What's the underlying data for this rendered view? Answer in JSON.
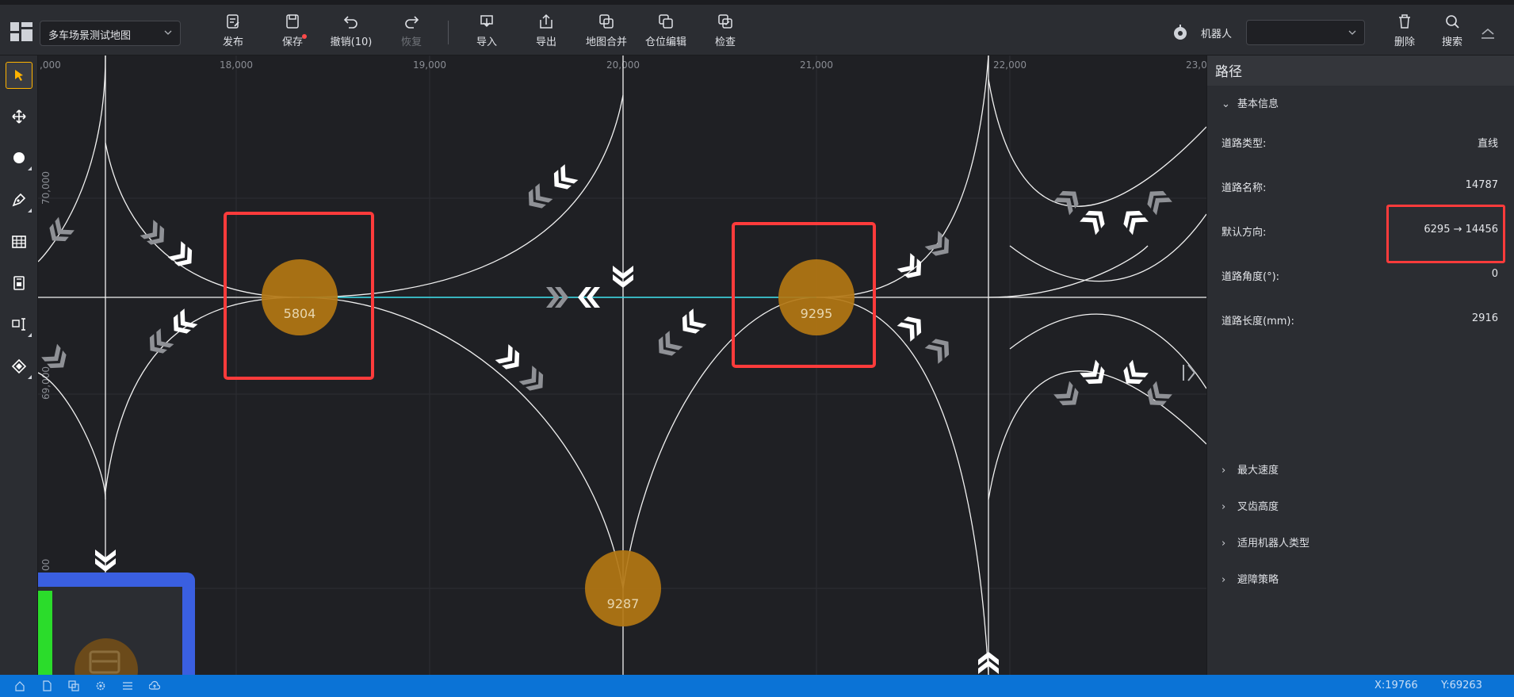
{
  "header": {
    "map_name": "多车场景测试地图",
    "tools": {
      "publish": "发布",
      "save": "保存",
      "undo": "撤销(10)",
      "redo": "恢复",
      "import": "导入",
      "export": "导出",
      "map_merge": "地图合并",
      "bin_edit": "仓位编辑",
      "check": "检查",
      "delete": "删除",
      "search": "搜索"
    },
    "robot_label": "机器人",
    "robot_value": ""
  },
  "canvas": {
    "ruler_x": [
      ",000",
      "18,000",
      "19,000",
      "20,000",
      "21,000",
      "22,000",
      "23,0"
    ],
    "ruler_y": [
      "70,000",
      "69,000",
      "00"
    ],
    "nodes": [
      {
        "id": "5804",
        "label": "5804"
      },
      {
        "id": "9295",
        "label": "9295"
      },
      {
        "id": "9287",
        "label": "9287"
      }
    ]
  },
  "panel": {
    "title": "路径",
    "basic_info": "基本信息",
    "props": [
      {
        "label": "道路类型:",
        "value": "直线"
      },
      {
        "label": "道路名称:",
        "value": "14787"
      },
      {
        "label": "默认方向:",
        "value": "6295 → 14456"
      },
      {
        "label": "道路角度(°):",
        "value": "0"
      },
      {
        "label": "道路长度(mm):",
        "value": "2916"
      }
    ],
    "sections": [
      {
        "label": "最大速度"
      },
      {
        "label": "叉齿高度"
      },
      {
        "label": "适用机器人类型"
      },
      {
        "label": "避障策略"
      }
    ]
  },
  "status": {
    "x": "X:19766",
    "y": "Y:69263"
  },
  "colors": {
    "accent": "#ffb300",
    "node": "#b37714",
    "highlight_box": "#ff3b3b",
    "selected_path": "#2ed3e0",
    "status_bar": "#0b73d6"
  }
}
